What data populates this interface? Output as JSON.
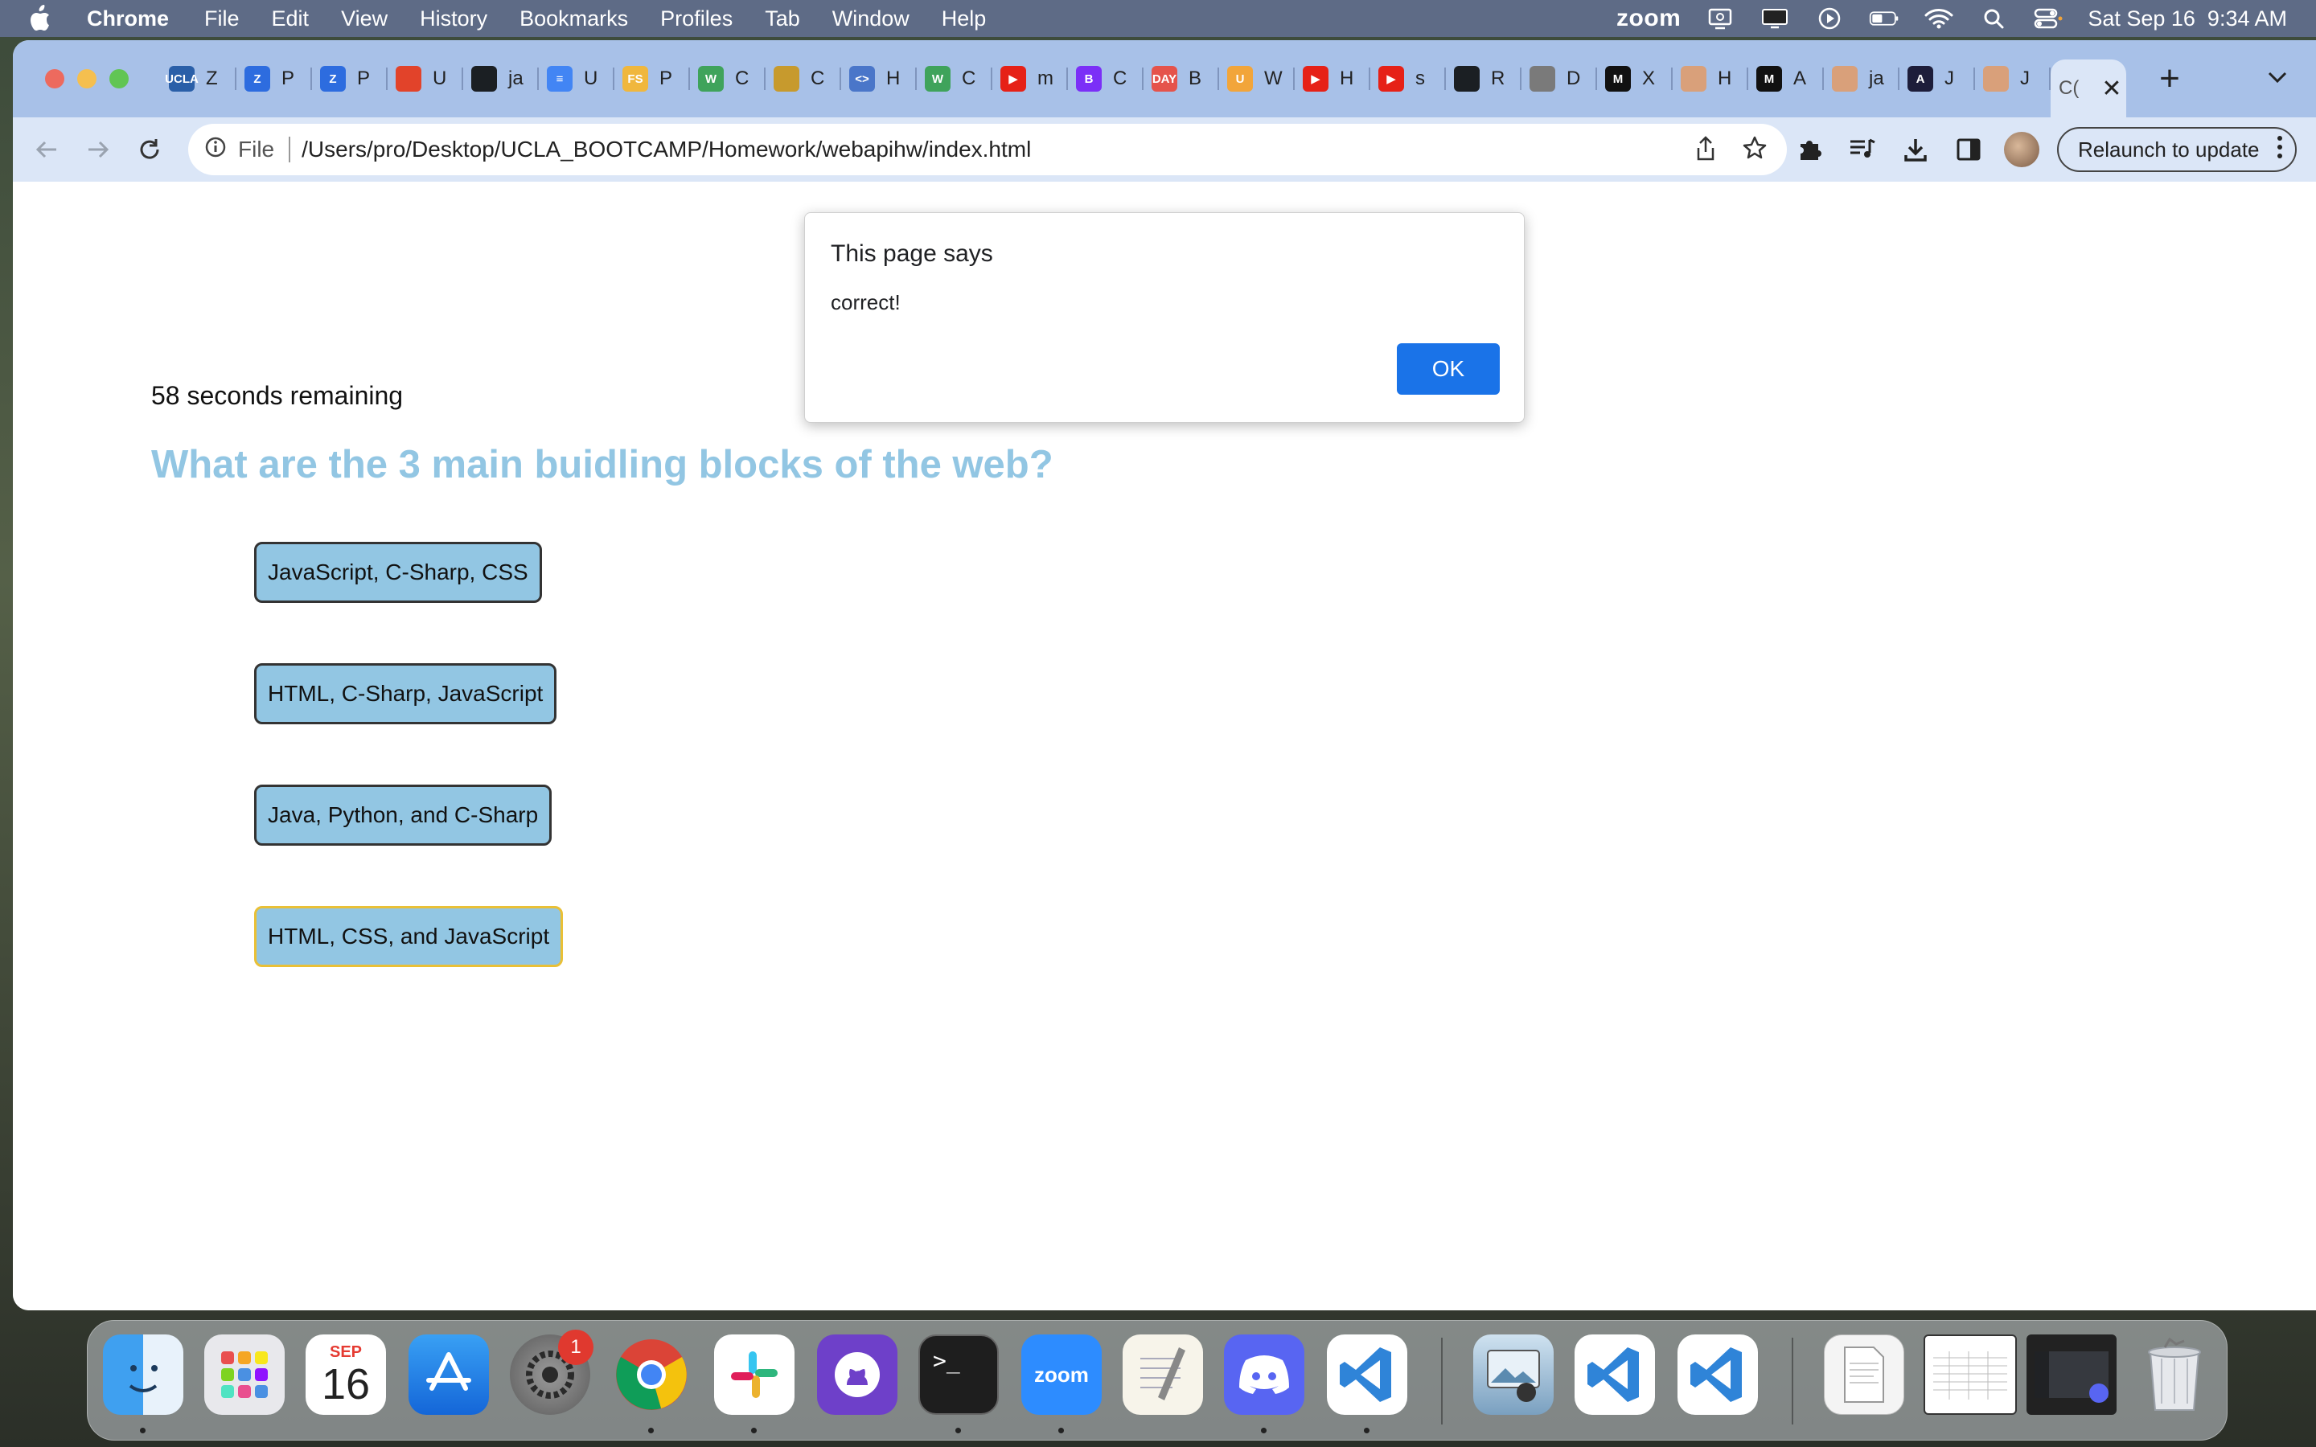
{
  "menubar": {
    "app_name": "Chrome",
    "items": [
      "File",
      "Edit",
      "View",
      "History",
      "Bookmarks",
      "Profiles",
      "Tab",
      "Window",
      "Help"
    ],
    "zoom_label": "zoom",
    "clock": "Sat Sep 16  9:34 AM"
  },
  "tabs": [
    {
      "fav_text": "UCLA",
      "fav_color": "#2a5fa8",
      "letter": "Z"
    },
    {
      "fav_text": "Z",
      "fav_color": "#2d6cdf",
      "letter": "P"
    },
    {
      "fav_text": "Z",
      "fav_color": "#2d6cdf",
      "letter": "P"
    },
    {
      "fav_text": "",
      "fav_color": "#e2432a",
      "letter": "U"
    },
    {
      "fav_text": "",
      "fav_color": "#1b1f23",
      "letter": "ja"
    },
    {
      "fav_text": "≡",
      "fav_color": "#4285f4",
      "letter": "U"
    },
    {
      "fav_text": "FS",
      "fav_color": "#f0b73d",
      "letter": "P"
    },
    {
      "fav_text": "W",
      "fav_color": "#3fa35b",
      "letter": "C"
    },
    {
      "fav_text": "",
      "fav_color": "#c79a2d",
      "letter": "C"
    },
    {
      "fav_text": "<>",
      "fav_color": "#4a76c9",
      "letter": "H"
    },
    {
      "fav_text": "W",
      "fav_color": "#3fa35b",
      "letter": "C"
    },
    {
      "fav_text": "▶",
      "fav_color": "#e62117",
      "letter": "m"
    },
    {
      "fav_text": "B",
      "fav_color": "#7b2ff7",
      "letter": "C"
    },
    {
      "fav_text": "DAY",
      "fav_color": "#e5534b",
      "letter": "B"
    },
    {
      "fav_text": "U",
      "fav_color": "#f2a53a",
      "letter": "W"
    },
    {
      "fav_text": "▶",
      "fav_color": "#e62117",
      "letter": "H"
    },
    {
      "fav_text": "▶",
      "fav_color": "#e62117",
      "letter": "s"
    },
    {
      "fav_text": "",
      "fav_color": "#1b1f23",
      "letter": "R"
    },
    {
      "fav_text": "",
      "fav_color": "#7a7a7a",
      "letter": "D"
    },
    {
      "fav_text": "M",
      "fav_color": "#111111",
      "letter": "X"
    },
    {
      "fav_text": "",
      "fav_color": "#d9a07a",
      "letter": "H"
    },
    {
      "fav_text": "M",
      "fav_color": "#111111",
      "letter": "A"
    },
    {
      "fav_text": "",
      "fav_color": "#d9a07a",
      "letter": "ja"
    },
    {
      "fav_text": "A",
      "fav_color": "#1d1d3a",
      "letter": "J"
    },
    {
      "fav_text": "",
      "fav_color": "#d9a07a",
      "letter": "J"
    }
  ],
  "active_tab": {
    "letter": "C("
  },
  "toolbar": {
    "scheme": "File",
    "url": "/Users/pro/Desktop/UCLA_BOOTCAMP/Homework/webapihw/index.html",
    "relaunch_label": "Relaunch to update"
  },
  "quiz": {
    "timer": "58 seconds remaining",
    "question": "What are the 3 main buidling blocks of the web?",
    "answers": [
      "JavaScript, C-Sharp, CSS",
      "HTML, C-Sharp, JavaScript",
      "Java, Python, and C-Sharp",
      "HTML, CSS, and JavaScript"
    ]
  },
  "dialog": {
    "title": "This page says",
    "message": "correct!",
    "ok_label": "OK"
  },
  "dock": {
    "calendar_month": "SEP",
    "calendar_day": "16",
    "settings_badge": "1",
    "zoom_label": "zoom"
  }
}
